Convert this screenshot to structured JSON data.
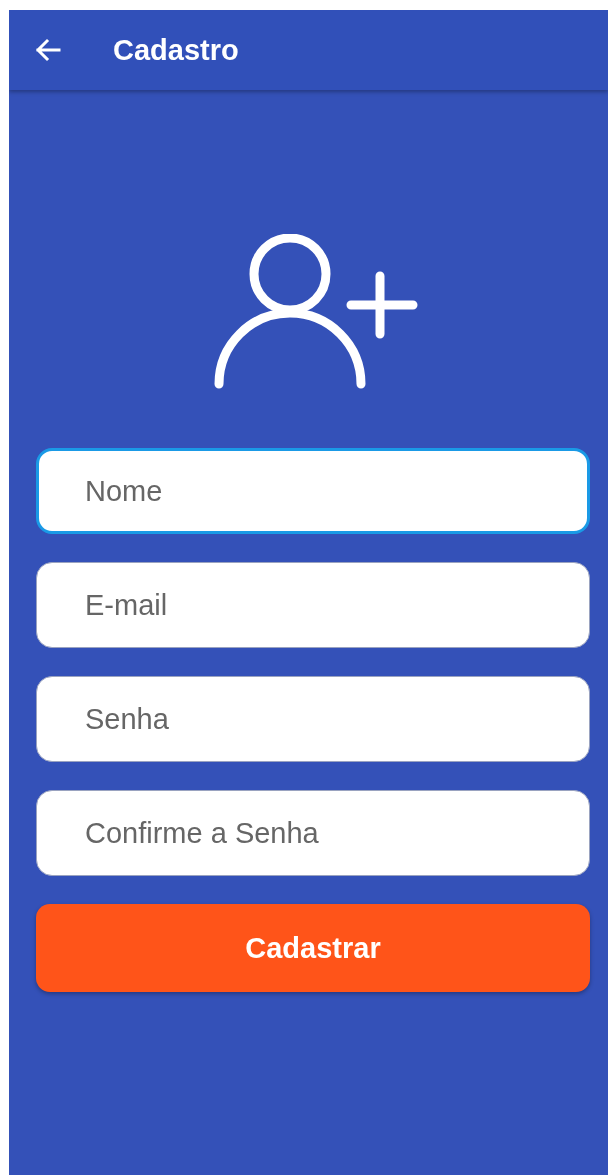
{
  "app_bar": {
    "title": "Cadastro"
  },
  "fields": [
    {
      "placeholder": "Nome",
      "focused": true
    },
    {
      "placeholder": "E-mail",
      "focused": false
    },
    {
      "placeholder": "Senha",
      "focused": false
    },
    {
      "placeholder": "Confirme a Senha",
      "focused": false
    }
  ],
  "submit_button": {
    "label": "Cadastrar"
  }
}
